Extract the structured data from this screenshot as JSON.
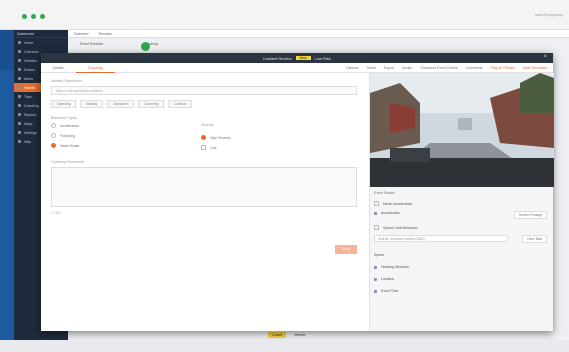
{
  "window": {
    "title_right": "user@company"
  },
  "sidebar": {
    "head": "Dashboard",
    "items": [
      {
        "label": "Home"
      },
      {
        "label": "Overview"
      },
      {
        "label": "Vehicles"
      },
      {
        "label": "Drivers"
      },
      {
        "label": "Alerts"
      },
      {
        "label": "Events",
        "active": true
      },
      {
        "label": "Trips"
      },
      {
        "label": "Coaching"
      },
      {
        "label": "Reports"
      },
      {
        "label": "Maps"
      },
      {
        "label": "Settings"
      },
      {
        "label": "Help"
      }
    ]
  },
  "main": {
    "top_tabs": [
      "Overview",
      "Reviews"
    ],
    "sub_left": "Event Reviews",
    "sub_right": "Coaching",
    "rows": [
      {
        "tag": "Coach",
        "text": "Vehicle"
      },
      {
        "tag": "Coach",
        "text": "Detail"
      }
    ]
  },
  "modal": {
    "title": "Incident Review",
    "badge": "New",
    "title_suffix": "Low Risk",
    "tabs": [
      "Details",
      "Coaching"
    ],
    "actions": [
      "Dismiss",
      "Share",
      "Export",
      "Assign",
      "Download Event Details",
      "Comments",
      "Flag for Review",
      "Mark Reviewed"
    ],
    "form": {
      "desc_label": "Incident Description",
      "desc_placeholder": "Add a note about this incident",
      "chips": [
        "Speeding",
        "Braking",
        "Distraction",
        "Cornering",
        "Collision"
      ],
      "options_label": "Behaviour Types",
      "col1": [
        {
          "label": "Acceleration",
          "on": false
        },
        {
          "label": "Following",
          "on": false
        },
        {
          "label": "Harsh Brake",
          "on": true
        }
      ],
      "col2_label": "Severity",
      "col2": [
        {
          "label": "High Severity",
          "on": true
        },
        {
          "label": "Low",
          "on": false
        }
      ],
      "comments_label": "Coaching Comments",
      "hint": "0 / 500",
      "save": "Save"
    },
    "right": {
      "section1": "Event Details",
      "row1": "Harsh Acceleration",
      "row1_sub": "Acceleration",
      "btn1": "Review Footage",
      "row2": "Speed Limit Breached",
      "field2": "Vehicle: Unknown Vehicle (AB12)",
      "btn2": "Open Map",
      "row3": "Speed",
      "row4": "Heading Direction",
      "row5": "Location",
      "row6": "Event Time"
    }
  }
}
